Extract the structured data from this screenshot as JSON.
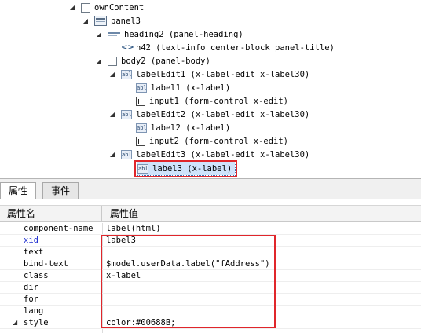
{
  "tree": {
    "items": [
      {
        "label": "ownContent",
        "expanded": true,
        "icon": "box-icon"
      },
      {
        "label": "panel3",
        "expanded": true,
        "icon": "panel-icon"
      },
      {
        "label": "heading2 (panel-heading)",
        "expanded": true,
        "icon": "heading-icon"
      },
      {
        "label": "h42 (text-info center-block panel-title)",
        "icon": "code-tag-icon"
      },
      {
        "label": "body2 (panel-body)",
        "expanded": true,
        "icon": "box-icon"
      },
      {
        "label": "labelEdit1 (x-label-edit x-label30)",
        "expanded": true,
        "icon": "label-edit-icon"
      },
      {
        "label": "label1 (x-label)",
        "icon": "label-icon"
      },
      {
        "label": "input1 (form-control x-edit)",
        "icon": "input-icon"
      },
      {
        "label": "labelEdit2 (x-label-edit x-label30)",
        "expanded": true,
        "icon": "label-edit-icon"
      },
      {
        "label": "label2 (x-label)",
        "icon": "label-icon"
      },
      {
        "label": "input2 (form-control x-edit)",
        "icon": "input-icon"
      },
      {
        "label": "labelEdit3 (x-label-edit x-label30)",
        "expanded": true,
        "icon": "label-edit-icon"
      },
      {
        "label": "label3 (x-label)",
        "icon": "label-icon",
        "selected": true
      }
    ],
    "icon_text": "abl"
  },
  "tabs": [
    {
      "label": "属性",
      "active": true
    },
    {
      "label": "事件",
      "active": false
    }
  ],
  "grid": {
    "header_name": "属性名",
    "header_value": "属性值",
    "rows": [
      {
        "name": "component-name",
        "value": "label(html)"
      },
      {
        "name": "xid",
        "value": "label3",
        "highlight_name": true
      },
      {
        "name": "text",
        "value": ""
      },
      {
        "name": "bind-text",
        "value": "$model.userData.label(\"fAddress\")"
      },
      {
        "name": "class",
        "value": "x-label"
      },
      {
        "name": "dir",
        "value": ""
      },
      {
        "name": "for",
        "value": ""
      },
      {
        "name": "lang",
        "value": ""
      },
      {
        "name": "style",
        "value": "color:#00688B;",
        "expandable": true
      }
    ]
  },
  "colors": {
    "highlight_box": "#e0262b",
    "selection": "#cfe3fb",
    "xid_name": "#1e2fd0"
  }
}
